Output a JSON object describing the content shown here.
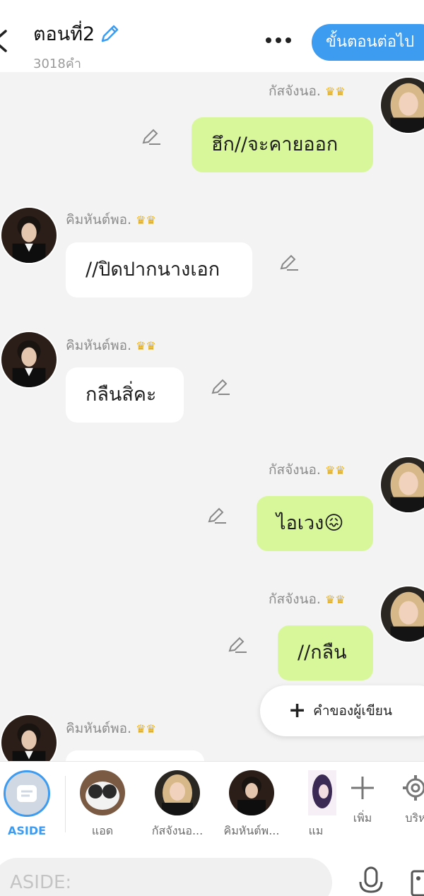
{
  "header": {
    "title": "ตอนที่2",
    "word_count": "3018คำ",
    "next_button": "ขั้นตอนต่อไป"
  },
  "messages": [
    {
      "speaker": "กัสจังนอ.",
      "text": "ฮึก//จะคายออก",
      "side": "right"
    },
    {
      "speaker": "คิมหันต์พอ.",
      "text": "//ปิดปากนางเอก",
      "side": "left"
    },
    {
      "speaker": "คิมหันต์พอ.",
      "text": "กลืนสิ่คะ",
      "side": "left"
    },
    {
      "speaker": "กัสจังนอ.",
      "text": "ไอเวง😖",
      "side": "right"
    },
    {
      "speaker": "กัสจังนอ.",
      "text": "//กลืน",
      "side": "right"
    },
    {
      "speaker": "คิมหันต์พอ.",
      "text": "",
      "side": "left"
    }
  ],
  "writer_button": "คำของผู้เขียน",
  "characters": [
    {
      "label": "ASIDE"
    },
    {
      "label": "แอด"
    },
    {
      "label": "กัสจังนอ..."
    },
    {
      "label": "คิมหันต์พ..."
    },
    {
      "label": "แม"
    },
    {
      "label": "เพิ่ม"
    },
    {
      "label": "บริห"
    }
  ],
  "input": {
    "placeholder": "ASIDE:"
  },
  "colors": {
    "accent": "#3d9bf0",
    "right_bubble": "#d8f79b",
    "left_bubble": "#ffffff",
    "background": "#f3f3f3"
  }
}
